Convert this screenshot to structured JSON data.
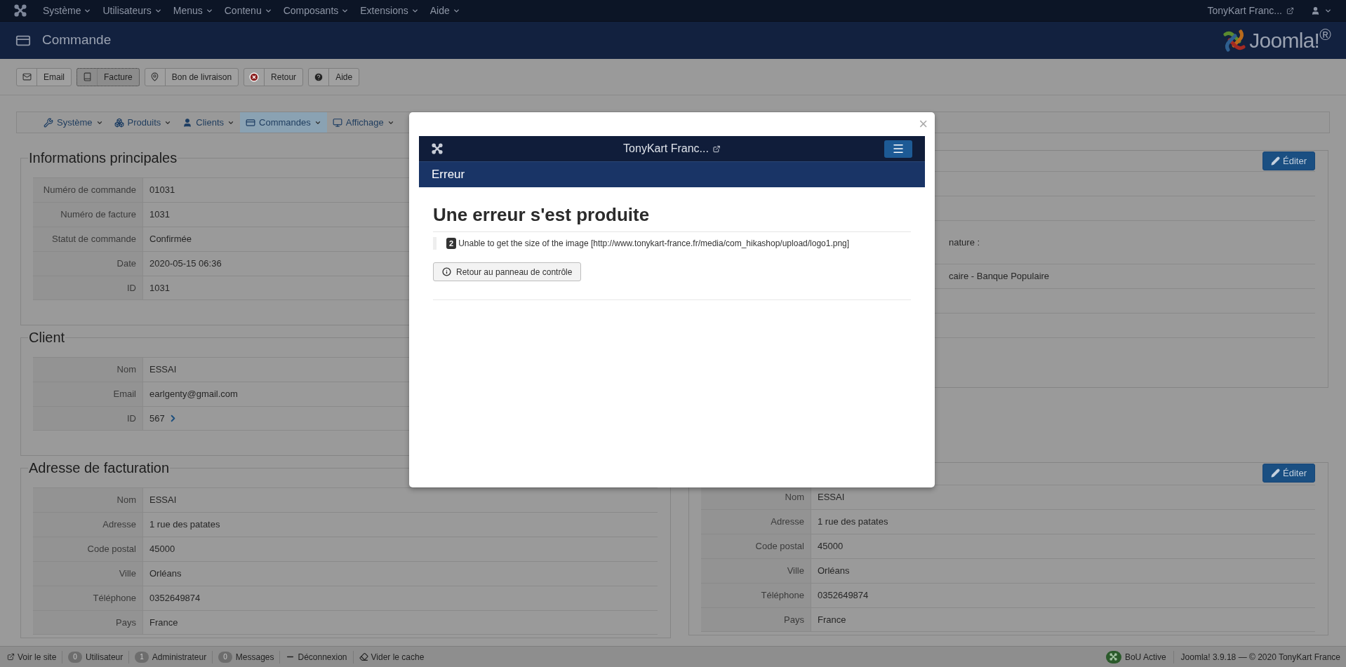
{
  "top_menu": {
    "items": [
      {
        "label": "Système"
      },
      {
        "label": "Utilisateurs"
      },
      {
        "label": "Menus"
      },
      {
        "label": "Contenu"
      },
      {
        "label": "Composants"
      },
      {
        "label": "Extensions"
      },
      {
        "label": "Aide"
      }
    ],
    "site_link": "TonyKart Franc..."
  },
  "header": {
    "title": "Commande",
    "brand": "Joomla!$^{®}$"
  },
  "toolbar": [
    {
      "label": "Email",
      "selected": false
    },
    {
      "label": "Facture",
      "selected": true
    },
    {
      "label": "Bon de livraison",
      "selected": false
    },
    {
      "label": "Retour",
      "selected": false
    },
    {
      "label": "Aide",
      "selected": false
    }
  ],
  "submenu": [
    {
      "label": "Système",
      "selected": false
    },
    {
      "label": "Produits",
      "selected": false
    },
    {
      "label": "Clients",
      "selected": false
    },
    {
      "label": "Commandes",
      "selected": true
    },
    {
      "label": "Affichage",
      "selected": false
    }
  ],
  "left_sections": [
    {
      "title": "Informations principales",
      "rows": [
        {
          "label": "Numéro de commande",
          "value": "01031"
        },
        {
          "label": "Numéro de facture",
          "value": "1031"
        },
        {
          "label": "Statut de commande",
          "value": "Confirmée"
        },
        {
          "label": "Date",
          "value": "2020-05-15 06:36"
        },
        {
          "label": "ID",
          "value": "1031"
        }
      ]
    },
    {
      "title": "Client",
      "rows": [
        {
          "label": "Nom",
          "value": "ESSAI"
        },
        {
          "label": "Email",
          "value": "earlgenty@gmail.com"
        },
        {
          "label": "ID",
          "value": "567",
          "link": true
        }
      ]
    },
    {
      "title": "Adresse de facturation",
      "rows": [
        {
          "label": "Nom",
          "value": "ESSAI"
        },
        {
          "label": "Adresse",
          "value": "1 rue des patates"
        },
        {
          "label": "Code postal",
          "value": "45000"
        },
        {
          "label": "Ville",
          "value": "Orléans"
        },
        {
          "label": "Téléphone",
          "value": "0352649874"
        },
        {
          "label": "Pays",
          "value": "France"
        }
      ]
    }
  ],
  "right_payment": {
    "button": "Éditer",
    "rows": [
      {
        "kind": "blank"
      },
      {
        "kind": "blank"
      },
      {
        "kind": "tall_text",
        "value": "nature :"
      },
      {
        "kind": "text",
        "value": "caire - Banque Populaire"
      },
      {
        "kind": "blank"
      },
      {
        "kind": "blank"
      }
    ]
  },
  "right_shipping": {
    "button": "Éditer",
    "rows": [
      {
        "label": "Nom",
        "value": "ESSAI"
      },
      {
        "label": "Adresse",
        "value": "1 rue des patates"
      },
      {
        "label": "Code postal",
        "value": "45000"
      },
      {
        "label": "Ville",
        "value": "Orléans"
      },
      {
        "label": "Téléphone",
        "value": "0352649874"
      },
      {
        "label": "Pays",
        "value": "France"
      }
    ]
  },
  "status_bar": {
    "left": [
      {
        "kind": "link",
        "label": "Voir le site"
      },
      {
        "kind": "count",
        "count": "0",
        "label": "Utilisateur"
      },
      {
        "kind": "count",
        "count": "1",
        "label": "Administrateur"
      },
      {
        "kind": "count",
        "count": "0",
        "label": "Messages"
      },
      {
        "kind": "logout",
        "label": "Déconnexion"
      },
      {
        "kind": "cache",
        "label": "Vider le cache"
      }
    ],
    "badge": "BoU Active",
    "version": "Joomla! 3.9.18 — © 2020 TonyKart France"
  },
  "modal": {
    "close": "×",
    "site_link": "TonyKart Franc...",
    "page_title": "Erreur",
    "heading": "Une erreur s'est produite",
    "error_count": "2",
    "message": "Unable to get the size of the image [http://www.tonykart-france.fr/media/com_hikashop/upload/logo1.png]",
    "button": "Retour au panneau de contrôle"
  }
}
